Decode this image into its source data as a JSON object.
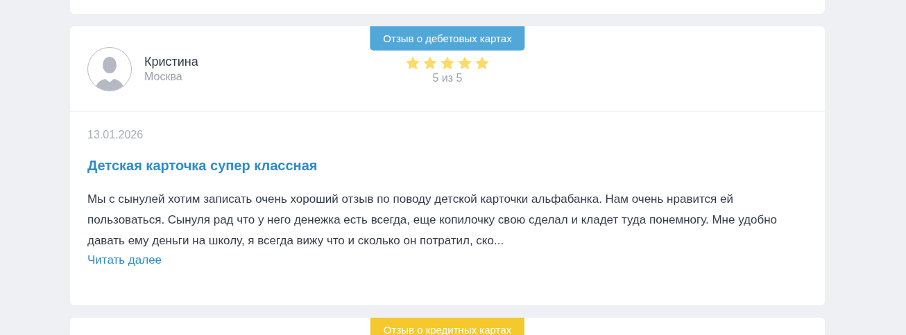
{
  "reviews": [
    {
      "kind": "stub"
    },
    {
      "kind": "full",
      "tag": {
        "label": "Отзыв о дебетовых картах",
        "color": "#52a7d9"
      },
      "author": {
        "name": "Кристина",
        "city": "Москва"
      },
      "stars": 5,
      "rating": "5 из 5",
      "date": "13.01.2026",
      "title": "Детская карточка супер классная",
      "text": "Мы с сынулей хотим записать очень хороший отзыв по поводу детской карточки альфабанка. Нам очень нравится ей пользоваться. Сынуля рад что у него денежка есть всегда, еще копилочку свою сделал и кладет туда понемногу. Мне удобно давать ему деньги на школу, я всегда вижу что и сколько он потратил, ско...",
      "more": "Читать далее"
    },
    {
      "kind": "cut",
      "tag": {
        "label": "Отзыв о кредитных картах",
        "color": "#f5c92e"
      }
    }
  ]
}
